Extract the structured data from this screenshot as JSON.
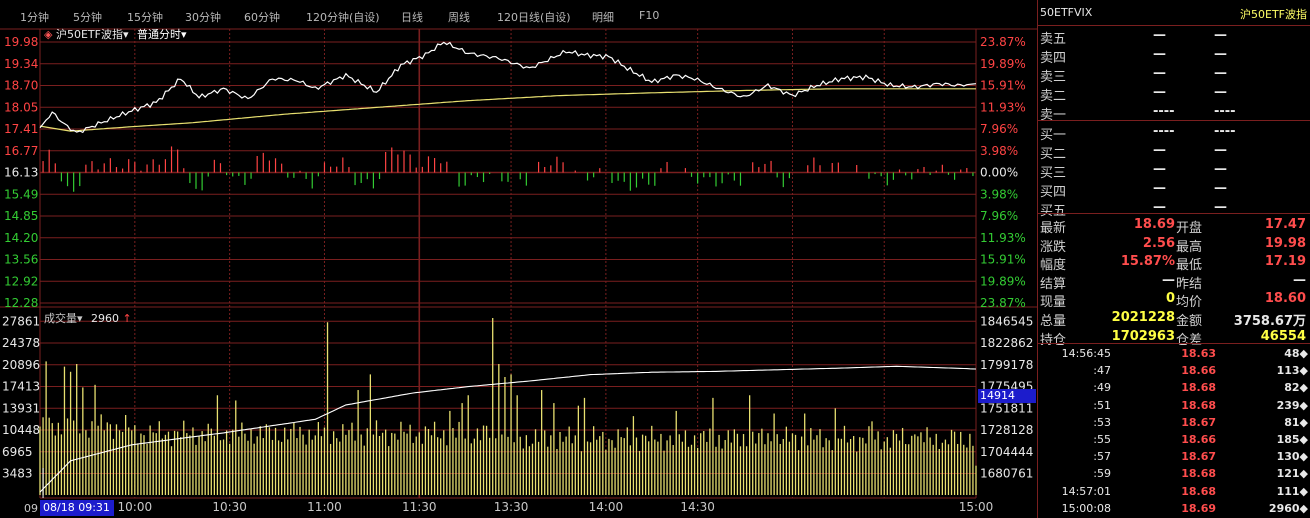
{
  "toolbar": [
    "1分钟",
    "5分钟",
    "15分钟",
    "30分钟",
    "60分钟",
    "120分钟(自设)",
    "日线",
    "周线",
    "120日线(自设)",
    "明细",
    "F10"
  ],
  "chart": {
    "indicator": "沪50ETF波指",
    "mode": "普通分时",
    "volume_label": "成交量",
    "volume_value": "2960",
    "cursor_value": "14914",
    "cursor_time": "08/18 09:31",
    "corner_label": "09"
  },
  "chart_data": {
    "type": "line",
    "price_axis": [
      "19.98",
      "19.34",
      "18.70",
      "18.05",
      "17.41",
      "16.77",
      "16.13",
      "15.49",
      "14.85",
      "14.20",
      "13.56",
      "12.92",
      "12.28"
    ],
    "pct_axis": [
      "23.87%",
      "19.89%",
      "15.91%",
      "11.93%",
      "7.96%",
      "3.98%",
      "0.00%",
      "3.98%",
      "7.96%",
      "11.93%",
      "15.91%",
      "19.89%",
      "23.87%"
    ],
    "ylim": [
      12.28,
      19.98
    ],
    "prev_close": 16.13,
    "vol_axis_left": [
      "27861",
      "24378",
      "20896",
      "17413",
      "13931",
      "10448",
      "6965",
      "3483"
    ],
    "vol_axis_right": [
      "1846545",
      "1822862",
      "1799178",
      "1775495",
      "1751811",
      "1728128",
      "1704444",
      "1680761"
    ],
    "vol_max": 31344,
    "cum_ylim": [
      1657078,
      1870228
    ],
    "time_labels": [
      "10:00",
      "10:30",
      "11:00",
      "11:30",
      "13:30",
      "14:00",
      "14:30",
      "15:00"
    ],
    "price_keypoints": [
      [
        0,
        17.45
      ],
      [
        4,
        17.9
      ],
      [
        8,
        17.55
      ],
      [
        12,
        17.3
      ],
      [
        20,
        17.6
      ],
      [
        30,
        17.95
      ],
      [
        38,
        18.2
      ],
      [
        46,
        18.9
      ],
      [
        52,
        18.35
      ],
      [
        60,
        18.6
      ],
      [
        68,
        18.3
      ],
      [
        76,
        18.9
      ],
      [
        84,
        18.85
      ],
      [
        90,
        18.6
      ],
      [
        100,
        19.0
      ],
      [
        110,
        18.5
      ],
      [
        118,
        19.3
      ],
      [
        126,
        19.6
      ],
      [
        132,
        19.98
      ],
      [
        140,
        19.65
      ],
      [
        150,
        19.5
      ],
      [
        160,
        19.2
      ],
      [
        166,
        19.45
      ],
      [
        172,
        19.7
      ],
      [
        178,
        19.6
      ],
      [
        186,
        19.55
      ],
      [
        192,
        19.2
      ],
      [
        200,
        18.8
      ],
      [
        208,
        19.0
      ],
      [
        214,
        18.9
      ],
      [
        222,
        18.6
      ],
      [
        230,
        18.35
      ],
      [
        238,
        18.7
      ],
      [
        246,
        18.4
      ],
      [
        254,
        18.7
      ],
      [
        262,
        18.9
      ],
      [
        270,
        18.95
      ],
      [
        278,
        18.7
      ],
      [
        286,
        18.65
      ],
      [
        294,
        18.75
      ],
      [
        300,
        18.7
      ],
      [
        306,
        18.75
      ]
    ],
    "avg_keypoints": [
      [
        0,
        17.5
      ],
      [
        10,
        17.35
      ],
      [
        25,
        17.45
      ],
      [
        50,
        17.6
      ],
      [
        80,
        17.85
      ],
      [
        110,
        18.05
      ],
      [
        140,
        18.25
      ],
      [
        170,
        18.4
      ],
      [
        200,
        18.48
      ],
      [
        230,
        18.55
      ],
      [
        260,
        18.6
      ],
      [
        290,
        18.6
      ],
      [
        306,
        18.6
      ]
    ],
    "cum_keypoints": [
      [
        0,
        1660761
      ],
      [
        10,
        1700000
      ],
      [
        30,
        1720000
      ],
      [
        60,
        1735000
      ],
      [
        90,
        1752000
      ],
      [
        100,
        1770000
      ],
      [
        122,
        1785000
      ],
      [
        140,
        1793000
      ],
      [
        160,
        1800000
      ],
      [
        180,
        1808000
      ],
      [
        200,
        1811000
      ],
      [
        220,
        1812000
      ],
      [
        240,
        1814000
      ],
      [
        260,
        1816000
      ],
      [
        280,
        1818500
      ],
      [
        300,
        1816000
      ],
      [
        306,
        1815000
      ],
      [
        307,
        1681000
      ]
    ],
    "vol_spikes": [
      [
        2,
        21500
      ],
      [
        8,
        20500
      ],
      [
        10,
        19500
      ],
      [
        12,
        21000
      ],
      [
        14,
        16500
      ],
      [
        18,
        17000
      ],
      [
        58,
        15000
      ],
      [
        64,
        14000
      ],
      [
        94,
        29000
      ],
      [
        104,
        16000
      ],
      [
        108,
        19000
      ],
      [
        134,
        12000
      ],
      [
        138,
        13500
      ],
      [
        140,
        15000
      ],
      [
        148,
        30500
      ],
      [
        150,
        21000
      ],
      [
        152,
        18500
      ],
      [
        154,
        19000
      ],
      [
        156,
        15000
      ],
      [
        164,
        16000
      ],
      [
        168,
        13500
      ],
      [
        176,
        13000
      ],
      [
        178,
        14500
      ],
      [
        194,
        11000
      ],
      [
        208,
        12000
      ],
      [
        220,
        14500
      ],
      [
        232,
        15000
      ],
      [
        240,
        11500
      ],
      [
        250,
        11500
      ],
      [
        260,
        12500
      ],
      [
        272,
        10000
      ],
      [
        286,
        7500
      ],
      [
        296,
        6500
      ],
      [
        306,
        1500
      ]
    ]
  },
  "panel": {
    "code": "50ETFVIX",
    "name": "沪50ETF波指",
    "asks": [
      {
        "label": "卖五",
        "price": "—",
        "vol": "—"
      },
      {
        "label": "卖四",
        "price": "—",
        "vol": "—"
      },
      {
        "label": "卖三",
        "price": "—",
        "vol": "—"
      },
      {
        "label": "卖二",
        "price": "—",
        "vol": "—"
      },
      {
        "label": "卖一",
        "price": "----",
        "vol": "----"
      }
    ],
    "bids": [
      {
        "label": "买一",
        "price": "----",
        "vol": "----"
      },
      {
        "label": "买二",
        "price": "—",
        "vol": "—"
      },
      {
        "label": "买三",
        "price": "—",
        "vol": "—"
      },
      {
        "label": "买四",
        "price": "—",
        "vol": "—"
      },
      {
        "label": "买五",
        "price": "—",
        "vol": "—"
      }
    ],
    "stats": [
      {
        "l1": "最新",
        "v1": "18.69",
        "c1": "red",
        "l2": "开盘",
        "v2": "17.47",
        "c2": "red"
      },
      {
        "l1": "涨跌",
        "v1": "2.56",
        "c1": "red",
        "l2": "最高",
        "v2": "19.98",
        "c2": "red"
      },
      {
        "l1": "幅度",
        "v1": "15.87%",
        "c1": "red",
        "l2": "最低",
        "v2": "17.19",
        "c2": "red"
      },
      {
        "l1": "结算",
        "v1": "—",
        "c1": "wht",
        "l2": "昨结",
        "v2": "—",
        "c2": "wht"
      },
      {
        "l1": "现量",
        "v1": "0",
        "c1": "yel",
        "l2": "均价",
        "v2": "18.60",
        "c2": "red"
      },
      {
        "l1": "总量",
        "v1": "2021228",
        "c1": "yel",
        "l2": "金额",
        "v2": "3758.67万",
        "c2": "wht"
      },
      {
        "l1": "持仓",
        "v1": "1702963",
        "c1": "yel",
        "l2": "仓差",
        "v2": "46554",
        "c2": "yel"
      }
    ],
    "ticks": [
      {
        "time": "14:56:45",
        "price": "18.63",
        "vol": "48"
      },
      {
        "time": ":47",
        "price": "18.66",
        "vol": "113"
      },
      {
        "time": ":49",
        "price": "18.68",
        "vol": "82"
      },
      {
        "time": ":51",
        "price": "18.68",
        "vol": "239"
      },
      {
        "time": ":53",
        "price": "18.67",
        "vol": "81"
      },
      {
        "time": ":55",
        "price": "18.66",
        "vol": "185"
      },
      {
        "time": ":57",
        "price": "18.67",
        "vol": "130"
      },
      {
        "time": ":59",
        "price": "18.68",
        "vol": "121"
      },
      {
        "time": "14:57:01",
        "price": "18.68",
        "vol": "111"
      },
      {
        "time": "15:00:08",
        "price": "18.69",
        "vol": "2960"
      }
    ],
    "tick_marker": "◆"
  },
  "colors": {
    "grid": "#7a1f1f",
    "price": "#ffffff",
    "avg": "#e8e070",
    "up": "#ff4444",
    "down": "#33cc33",
    "vol": "#e8e070",
    "cursor": "#1c1ccc"
  }
}
